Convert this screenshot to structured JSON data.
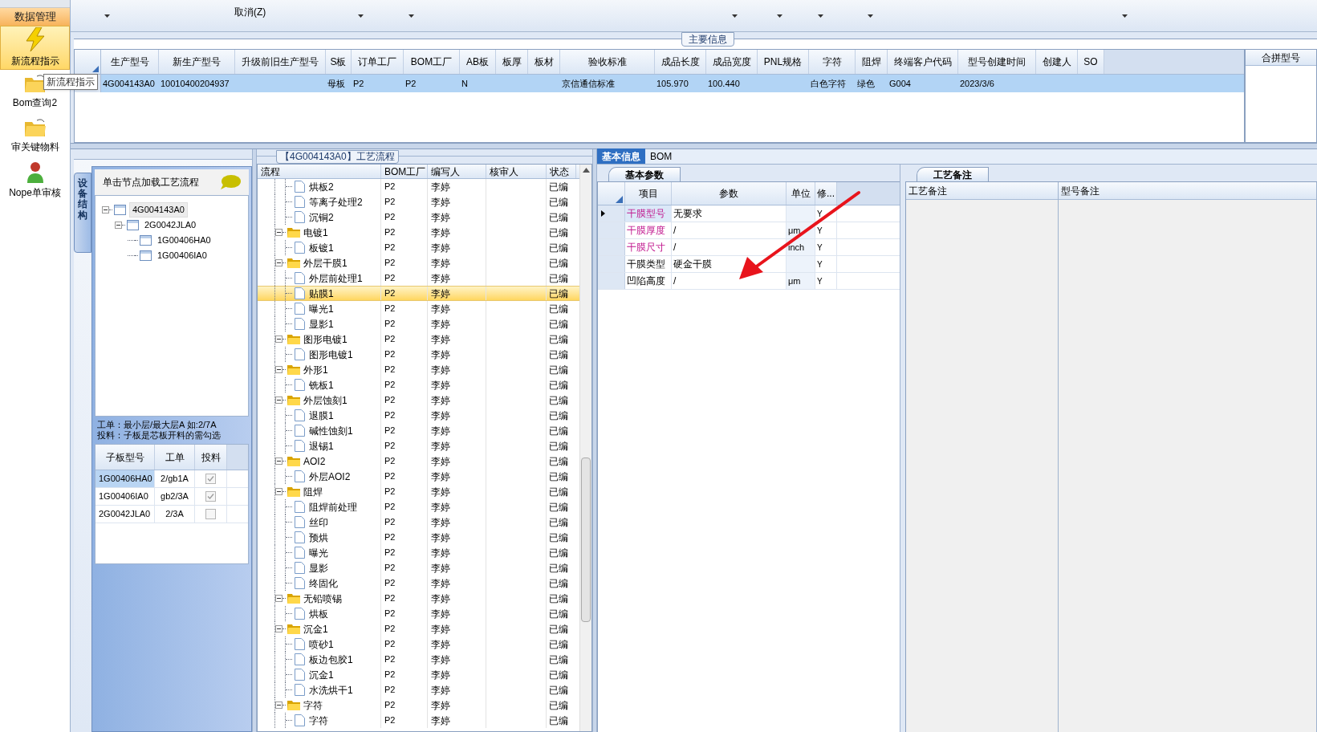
{
  "sidebar": {
    "section": "数据管理",
    "tooltip": "新流程指示",
    "items": [
      {
        "label": "新流程指示",
        "kind": "bolt",
        "selected": true
      },
      {
        "label": "Bom查询2",
        "kind": "folder",
        "selected": false
      },
      {
        "label": "审关键物料",
        "kind": "folder",
        "selected": false
      },
      {
        "label": "Nope单审核",
        "kind": "person",
        "selected": false
      }
    ]
  },
  "toolbar": {
    "cancel": "取消(Z)"
  },
  "main_info": {
    "title": "主要信息",
    "columns": [
      "生产型号",
      "新生产型号",
      "升级前旧生产型号",
      "S板",
      "订单工厂",
      "BOM工厂",
      "AB板",
      "板厚",
      "板材",
      "验收标准",
      "成品长度",
      "成品宽度",
      "PNL规格",
      "字符",
      "阻焊",
      "终端客户代码",
      "型号创建时间",
      "创建人",
      "SO"
    ],
    "rows": [
      {
        "selected": true,
        "cells": [
          "4G004143A0",
          "10010400204937",
          "",
          "母板",
          "P2",
          "P2",
          "N",
          "",
          "",
          "京信通信标准",
          "105.970",
          "100.440",
          "",
          "白色字符",
          "绿色",
          "G004",
          "2023/3/6",
          "",
          ""
        ]
      }
    ],
    "side_column": "合拼型号"
  },
  "structure": {
    "tab": "设备结构",
    "header": "单击节点加载工艺流程",
    "tree": [
      {
        "label": "4G004143A0",
        "selected": true,
        "expanded": true,
        "children": [
          {
            "label": "2G0042JLA0",
            "selected": false,
            "expanded": true,
            "children": [
              {
                "label": "1G00406HA0",
                "selected": false
              },
              {
                "label": "1G00406IA0",
                "selected": false
              }
            ]
          }
        ]
      }
    ],
    "note": "工单：最小层/最大层A 如:2/7A\n投料：子板是芯板开料的需勾选",
    "columns": [
      "子板型号",
      "工单",
      "投料"
    ],
    "rows": [
      {
        "sub_model": "1G00406HA0",
        "work_order": "2/gb1A",
        "feed": true,
        "selected": true
      },
      {
        "sub_model": "1G00406IA0",
        "work_order": "gb2/3A",
        "feed": true,
        "selected": false
      },
      {
        "sub_model": "2G0042JLA0",
        "work_order": "2/3A",
        "feed": false,
        "selected": false
      }
    ]
  },
  "flow": {
    "title": "【4G004143A0】工艺流程",
    "columns": [
      "流程",
      "BOM工厂",
      "编写人",
      "核审人",
      "状态"
    ],
    "items": [
      {
        "kind": "step",
        "name": "烘板2",
        "factory": "P2",
        "writer": "李婷",
        "status": "已编",
        "selected": false
      },
      {
        "kind": "step",
        "name": "等离子处理2",
        "factory": "P2",
        "writer": "李婷",
        "status": "已编",
        "selected": false
      },
      {
        "kind": "step",
        "name": "沉铜2",
        "factory": "P2",
        "writer": "李婷",
        "status": "已编",
        "selected": false
      },
      {
        "kind": "group",
        "name": "电镀1",
        "factory": "P2",
        "writer": "李婷",
        "status": "已编",
        "selected": false,
        "expanded": true,
        "children": [
          {
            "kind": "step",
            "name": "板镀1",
            "factory": "P2",
            "writer": "李婷",
            "status": "已编",
            "selected": false
          }
        ]
      },
      {
        "kind": "group",
        "name": "外层干膜1",
        "factory": "P2",
        "writer": "李婷",
        "status": "已编",
        "selected": false,
        "expanded": true,
        "children": [
          {
            "kind": "step",
            "name": "外层前处理1",
            "factory": "P2",
            "writer": "李婷",
            "status": "已编",
            "selected": false
          },
          {
            "kind": "step",
            "name": "贴膜1",
            "factory": "P2",
            "writer": "李婷",
            "status": "已编",
            "selected": true
          },
          {
            "kind": "step",
            "name": "曝光1",
            "factory": "P2",
            "writer": "李婷",
            "status": "已编",
            "selected": false
          },
          {
            "kind": "step",
            "name": "显影1",
            "factory": "P2",
            "writer": "李婷",
            "status": "已编",
            "selected": false
          }
        ]
      },
      {
        "kind": "group",
        "name": "图形电镀1",
        "factory": "P2",
        "writer": "李婷",
        "status": "已编",
        "selected": false,
        "expanded": true,
        "children": [
          {
            "kind": "step",
            "name": "图形电镀1",
            "factory": "P2",
            "writer": "李婷",
            "status": "已编",
            "selected": false
          }
        ]
      },
      {
        "kind": "group",
        "name": "外形1",
        "factory": "P2",
        "writer": "李婷",
        "status": "已编",
        "selected": false,
        "expanded": true,
        "children": [
          {
            "kind": "step",
            "name": "铣板1",
            "factory": "P2",
            "writer": "李婷",
            "status": "已编",
            "selected": false
          }
        ]
      },
      {
        "kind": "group",
        "name": "外层蚀刻1",
        "factory": "P2",
        "writer": "李婷",
        "status": "已编",
        "selected": false,
        "expanded": true,
        "children": [
          {
            "kind": "step",
            "name": "退膜1",
            "factory": "P2",
            "writer": "李婷",
            "status": "已编",
            "selected": false
          },
          {
            "kind": "step",
            "name": "碱性蚀刻1",
            "factory": "P2",
            "writer": "李婷",
            "status": "已编",
            "selected": false
          },
          {
            "kind": "step",
            "name": "退锡1",
            "factory": "P2",
            "writer": "李婷",
            "status": "已编",
            "selected": false
          }
        ]
      },
      {
        "kind": "group",
        "name": "AOI2",
        "factory": "P2",
        "writer": "李婷",
        "status": "已编",
        "selected": false,
        "expanded": true,
        "children": [
          {
            "kind": "step",
            "name": "外层AOI2",
            "factory": "P2",
            "writer": "李婷",
            "status": "已编",
            "selected": false
          }
        ]
      },
      {
        "kind": "group",
        "name": "阻焊",
        "factory": "P2",
        "writer": "李婷",
        "status": "已编",
        "selected": false,
        "expanded": true,
        "children": [
          {
            "kind": "step",
            "name": "阻焊前处理",
            "factory": "P2",
            "writer": "李婷",
            "status": "已编",
            "selected": false
          },
          {
            "kind": "step",
            "name": "丝印",
            "factory": "P2",
            "writer": "李婷",
            "status": "已编",
            "selected": false
          },
          {
            "kind": "step",
            "name": "预烘",
            "factory": "P2",
            "writer": "李婷",
            "status": "已编",
            "selected": false
          },
          {
            "kind": "step",
            "name": "曝光",
            "factory": "P2",
            "writer": "李婷",
            "status": "已编",
            "selected": false
          },
          {
            "kind": "step",
            "name": "显影",
            "factory": "P2",
            "writer": "李婷",
            "status": "已编",
            "selected": false
          },
          {
            "kind": "step",
            "name": "终固化",
            "factory": "P2",
            "writer": "李婷",
            "status": "已编",
            "selected": false
          }
        ]
      },
      {
        "kind": "group",
        "name": "无铅喷锡",
        "factory": "P2",
        "writer": "李婷",
        "status": "已编",
        "selected": false,
        "expanded": true,
        "children": [
          {
            "kind": "step",
            "name": "烘板",
            "factory": "P2",
            "writer": "李婷",
            "status": "已编",
            "selected": false
          }
        ]
      },
      {
        "kind": "group",
        "name": "沉金1",
        "factory": "P2",
        "writer": "李婷",
        "status": "已编",
        "selected": false,
        "expanded": true,
        "children": [
          {
            "kind": "step",
            "name": "喷砂1",
            "factory": "P2",
            "writer": "李婷",
            "status": "已编",
            "selected": false
          },
          {
            "kind": "step",
            "name": "板边包胶1",
            "factory": "P2",
            "writer": "李婷",
            "status": "已编",
            "selected": false
          },
          {
            "kind": "step",
            "name": "沉金1",
            "factory": "P2",
            "writer": "李婷",
            "status": "已编",
            "selected": false
          },
          {
            "kind": "step",
            "name": "水洗烘干1",
            "factory": "P2",
            "writer": "李婷",
            "status": "已编",
            "selected": false
          }
        ]
      },
      {
        "kind": "group",
        "name": "字符",
        "factory": "P2",
        "writer": "李婷",
        "status": "已编",
        "selected": false,
        "expanded": true,
        "children": [
          {
            "kind": "step",
            "name": "字符",
            "factory": "P2",
            "writer": "李婷",
            "status": "已编",
            "selected": false
          }
        ]
      }
    ]
  },
  "detail_tabs": [
    {
      "label": "基本信息",
      "selected": true
    },
    {
      "label": "BOM",
      "selected": false
    }
  ],
  "params": {
    "tab": "基本参数",
    "columns": [
      "项目",
      "参数",
      "单位",
      "修..."
    ],
    "rows": [
      {
        "item": "干膜型号",
        "value": "无要求",
        "unit": "",
        "flag": "Y",
        "required": true,
        "current": true
      },
      {
        "item": "干膜厚度",
        "value": "/",
        "unit": "μm",
        "flag": "Y",
        "required": true,
        "current": false
      },
      {
        "item": "干膜尺寸",
        "value": "/",
        "unit": "inch",
        "flag": "Y",
        "required": true,
        "current": false
      },
      {
        "item": "干膜类型",
        "value": "硬金干膜",
        "unit": "",
        "flag": "Y",
        "required": false,
        "current": false
      },
      {
        "item": "凹陷高度",
        "value": "/",
        "unit": "μm",
        "flag": "Y",
        "required": false,
        "current": false
      }
    ]
  },
  "notes": {
    "tab": "工艺备注",
    "columns": [
      "工艺备注",
      "型号备注"
    ]
  }
}
